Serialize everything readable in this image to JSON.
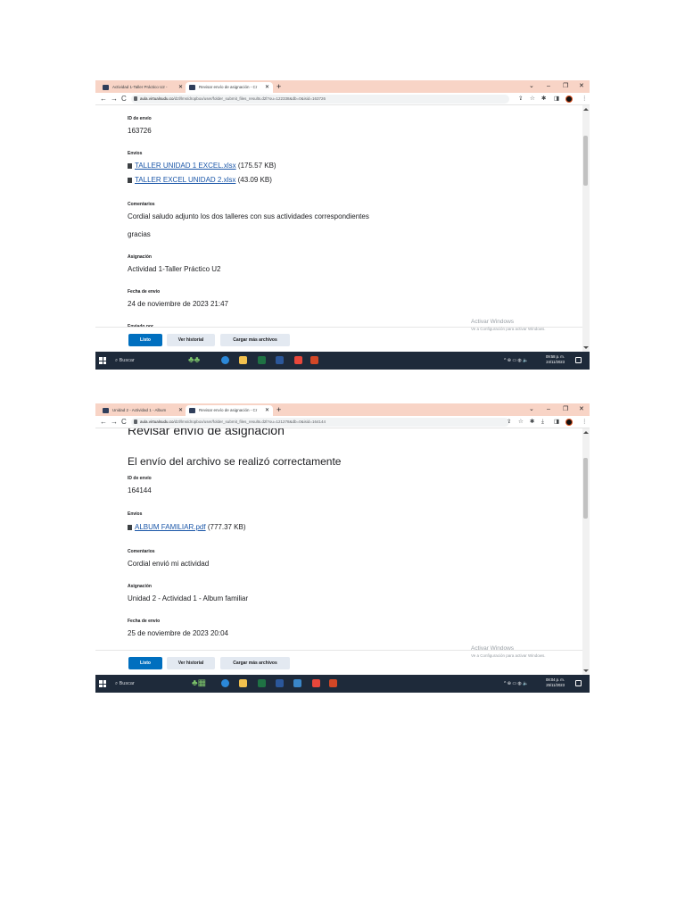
{
  "screenshots": [
    {
      "tabs": [
        {
          "label": "Actividad 1-Taller Práctico U2 -"
        },
        {
          "label": "Revisar envío de asignación - Cr"
        }
      ],
      "window_controls": {
        "minimize": "–",
        "restore": "❐",
        "close": "✕"
      },
      "address": {
        "domain": "aula.virtualsudu.co",
        "path": "/d2l/lms/dropbox/user/folder_submit_files_results.d2l?ou=122338&db=0&isid=163726"
      },
      "fields": {
        "id_label": "ID de envío",
        "id_value": "163726",
        "files_label": "Envíos",
        "files": [
          {
            "name": "TALLER UNIDAD 1 EXCEL.xlsx",
            "size": "(175.57 KB)"
          },
          {
            "name": "TALLER EXCEL UNIDAD 2.xlsx",
            "size": "(43.09 KB)"
          }
        ],
        "comments_label": "Comentarios",
        "comments_line1": "Cordial saludo adjunto los dos talleres con sus actividades correspondientes",
        "comments_line2": "gracias",
        "assignment_label": "Asignación",
        "assignment_value": "Actividad 1-Taller Práctico U2",
        "date_label": "Fecha de envío",
        "date_value": "24 de noviembre de 2023 21:47",
        "cutoff_label": "Enviado por"
      },
      "buttons": {
        "done": "Listo",
        "history": "Ver historial",
        "upload": "Cargar más archivos"
      },
      "watermark": {
        "title": "Activar Windows",
        "subtitle": "Ve a Configuración para activar Windows."
      },
      "taskbar": {
        "search": "Buscar",
        "time": "09:58 p. m.",
        "date": "24/11/2023"
      }
    },
    {
      "tabs": [
        {
          "label": "Unidad 2 - Actividad 1 - Album"
        },
        {
          "label": "Revisar envío de asignación - Cr"
        }
      ],
      "window_controls": {
        "minimize": "–",
        "restore": "❐",
        "close": "✕"
      },
      "address": {
        "domain": "aula.virtualsudu.co",
        "path": "/d2l/lms/dropbox/user/folder_submit_files_results.d2l?ou=121278&db=0&isid=164144"
      },
      "fields": {
        "page_title": "Revisar envío de asignación",
        "success_heading": "El envío del archivo se realizó correctamente",
        "id_label": "ID de envío",
        "id_value": "164144",
        "files_label": "Envíos",
        "files": [
          {
            "name": "ALBUM FAMILIAR.pdf",
            "size": "(777.37 KB)"
          }
        ],
        "comments_label": "Comentarios",
        "comments_line1": "Cordial envió mi actividad",
        "assignment_label": "Asignación",
        "assignment_value": "Unidad 2 - Actividad 1 - Album familiar",
        "date_label": "Fecha de envío",
        "date_value": "25 de noviembre de 2023 20:04"
      },
      "buttons": {
        "done": "Listo",
        "history": "Ver historial",
        "upload": "Cargar más archivos"
      },
      "watermark": {
        "title": "Activar Windows",
        "subtitle": "Ve a Configuración para activar Windows."
      },
      "taskbar": {
        "search": "Buscar",
        "time": "08:04 p. m.",
        "date": "25/11/2023"
      }
    }
  ],
  "colors": {
    "tabstrip": "#f8d4c6",
    "primary_button": "#006fbf",
    "secondary_button": "#e3e9f1",
    "link": "#1a56a8",
    "taskbar": "#1e2a3a"
  }
}
